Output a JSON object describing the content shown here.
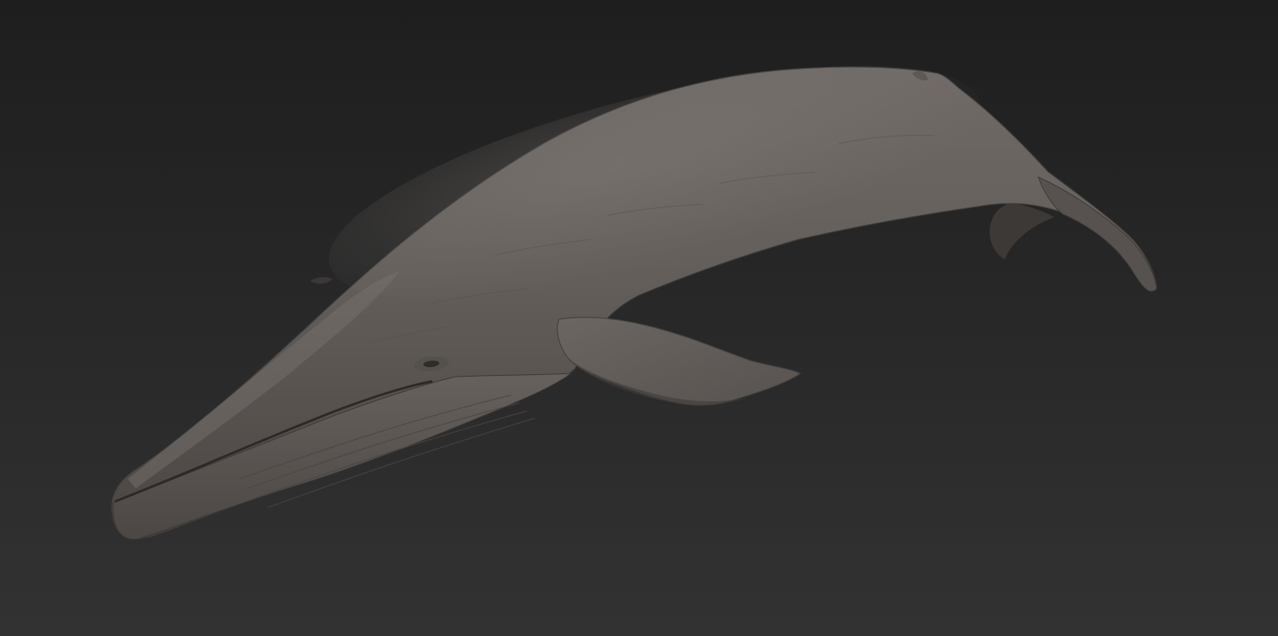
{
  "scene": {
    "subject": "whale-sculpt",
    "background_color_top": "#1e1e1e",
    "background_color_bottom": "#323232",
    "model_color": "#5f5a57",
    "model_highlight": "#7a7470",
    "model_shadow": "#3a3634"
  }
}
